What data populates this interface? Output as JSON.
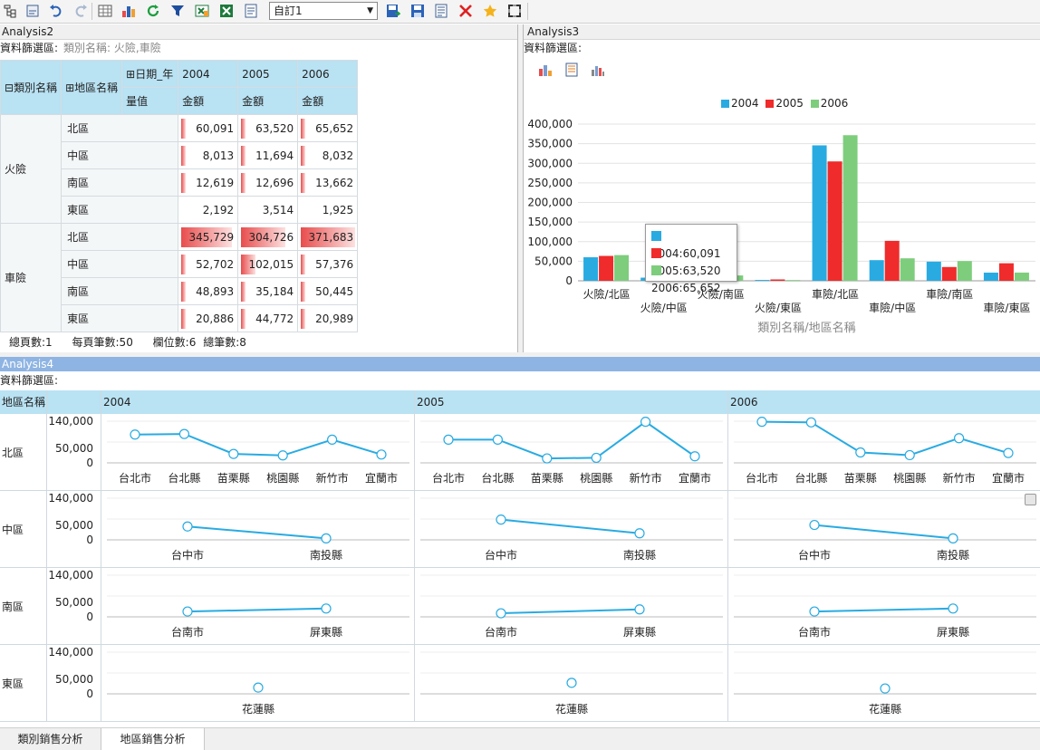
{
  "toolbar": {
    "icons": [
      "tree-icon",
      "properties-icon",
      "undo-icon",
      "redo-icon",
      "grid-icon",
      "chart-icon",
      "refresh-icon",
      "filter-icon",
      "export-excel-icon",
      "excel-icon",
      "report-icon"
    ],
    "view_select": "自訂1",
    "actions": [
      "save-as-icon",
      "save-icon",
      "layout-icon",
      "delete-icon",
      "favorite-icon",
      "fullscreen-icon"
    ]
  },
  "analysis2": {
    "title": "Analysis2",
    "filter_label": "資料篩選區:",
    "filter_value": "類別名稱: 火險,車險",
    "headers": {
      "category": "類別名稱",
      "region": "地區名稱",
      "date_year": "日期_年",
      "measure": "量值",
      "years": [
        "2004",
        "2005",
        "2006"
      ],
      "amount": "金額"
    },
    "rows": [
      {
        "category": "火險",
        "regions": [
          {
            "name": "北區",
            "values": [
              "60,091",
              "63,520",
              "65,652"
            ],
            "fill": [
              0.08,
              0.09,
              0.09
            ]
          },
          {
            "name": "中區",
            "values": [
              "8,013",
              "11,694",
              "8,032"
            ],
            "fill": [
              0.02,
              0.03,
              0.02
            ]
          },
          {
            "name": "南區",
            "values": [
              "12,619",
              "12,696",
              "13,662"
            ],
            "fill": [
              0.03,
              0.03,
              0.03
            ]
          },
          {
            "name": "東區",
            "values": [
              "2,192",
              "3,514",
              "1,925"
            ],
            "fill": [
              0,
              0,
              0
            ]
          }
        ]
      },
      {
        "category": "車險",
        "regions": [
          {
            "name": "北區",
            "values": [
              "345,729",
              "304,726",
              "371,683"
            ],
            "fill": [
              0.93,
              0.82,
              1.0
            ]
          },
          {
            "name": "中區",
            "values": [
              "52,702",
              "102,015",
              "57,376"
            ],
            "fill": [
              0.06,
              0.27,
              0.06
            ]
          },
          {
            "name": "南區",
            "values": [
              "48,893",
              "35,184",
              "50,445"
            ],
            "fill": [
              0.05,
              0.04,
              0.05
            ]
          },
          {
            "name": "東區",
            "values": [
              "20,886",
              "44,772",
              "20,989"
            ],
            "fill": [
              0.03,
              0.05,
              0.03
            ]
          }
        ]
      }
    ],
    "summary": {
      "total_pages": "總頁數:1",
      "per_page": "每頁筆數:50",
      "columns": "欄位數:6",
      "total_rows": "總筆數:8"
    }
  },
  "analysis3": {
    "title": "Analysis3",
    "filter_label": "資料篩選區:",
    "tooltip": [
      "2004:60,091",
      "2005:63,520",
      "2006:65,652"
    ]
  },
  "chart_data": {
    "type": "bar",
    "categories": [
      "火險/北區",
      "火險/中區",
      "火險/南區",
      "火險/東區",
      "車險/北區",
      "車險/中區",
      "車險/南區",
      "車險/東區"
    ],
    "series": [
      {
        "name": "2004",
        "color": "#29abe2",
        "values": [
          60091,
          8013,
          12619,
          2192,
          345729,
          52702,
          48893,
          20886
        ]
      },
      {
        "name": "2005",
        "color": "#ef2b2b",
        "values": [
          63520,
          11694,
          12696,
          3514,
          304726,
          102015,
          35184,
          44772
        ]
      },
      {
        "name": "2006",
        "color": "#7dcd7d",
        "values": [
          65652,
          8032,
          13662,
          1925,
          371683,
          57376,
          50445,
          20989
        ]
      }
    ],
    "xlabel": "類別名稱/地區名稱",
    "ylabel": "",
    "ylim": [
      0,
      400000
    ],
    "yticks": [
      "0",
      "50,000",
      "100,000",
      "150,000",
      "200,000",
      "250,000",
      "300,000",
      "350,000",
      "400,000"
    ],
    "legend": "top"
  },
  "analysis4": {
    "title": "Analysis4",
    "filter_label": "資料篩選區:",
    "corner": "地區名稱",
    "years": [
      "2004",
      "2005",
      "2006"
    ],
    "yticks": [
      "140,000",
      "50,000",
      "0"
    ],
    "ymax": 140000,
    "rows": [
      {
        "region": "北區",
        "cities": [
          "台北市",
          "台北縣",
          "苗栗縣",
          "桃園縣",
          "新竹市",
          "宜蘭市"
        ],
        "values": [
          [
            95000,
            97000,
            30000,
            25000,
            78000,
            28000
          ],
          [
            78000,
            78000,
            15000,
            17000,
            138000,
            22000
          ],
          [
            138000,
            136000,
            35000,
            26000,
            83000,
            33000
          ]
        ]
      },
      {
        "region": "中區",
        "cities": [
          "台中市",
          "南投縣"
        ],
        "values": [
          [
            45000,
            5000
          ],
          [
            68000,
            22000
          ],
          [
            50000,
            5000
          ]
        ]
      },
      {
        "region": "南區",
        "cities": [
          "台南市",
          "屏東縣"
        ],
        "values": [
          [
            18000,
            28000
          ],
          [
            12000,
            25000
          ],
          [
            18000,
            28000
          ]
        ]
      },
      {
        "region": "東區",
        "cities": [
          "花蓮縣"
        ],
        "values": [
          [
            21000
          ],
          [
            37000
          ],
          [
            18000
          ]
        ]
      }
    ],
    "line_color": "#29abe2"
  },
  "tabs": [
    "類別銷售分析",
    "地區銷售分析"
  ]
}
